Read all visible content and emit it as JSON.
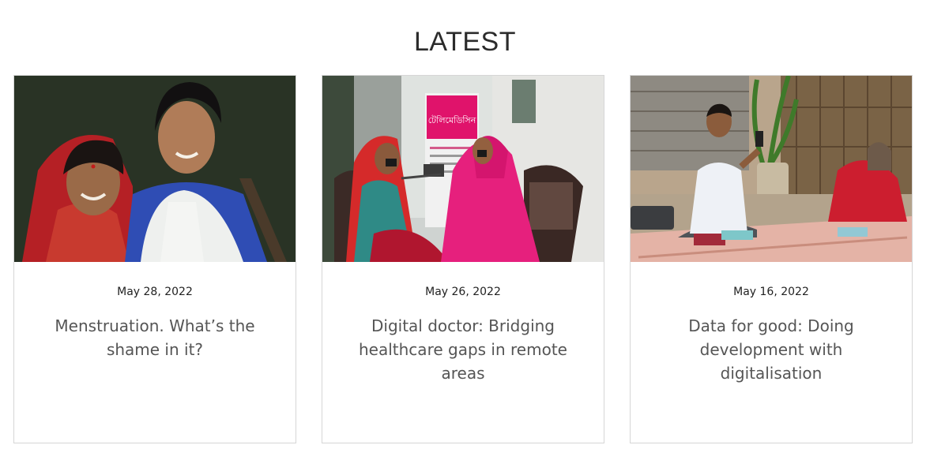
{
  "section": {
    "heading": "LATEST"
  },
  "articles": [
    {
      "date": "May 28, 2022",
      "title": "Menstruation. What’s the shame in it?",
      "photo_alt": "Smiling mother and daughter"
    },
    {
      "date": "May 26, 2022",
      "title": "Digital doctor: Bridging healthcare gaps in remote areas",
      "photo_alt": "Health worker checking a woman's blood pressure in front of a telemedicine banner",
      "banner_text": "টেলিমেডিসিন"
    },
    {
      "date": "May 16, 2022",
      "title": "Data for good: Doing development with digitalisation",
      "photo_alt": "Man taking a photo with a phone while sitting on a mat with a woman"
    }
  ],
  "colors": {
    "border": "#d6d6d6",
    "title_text": "#555555",
    "date_text": "#222222",
    "heading_text": "#2b2b2b"
  }
}
